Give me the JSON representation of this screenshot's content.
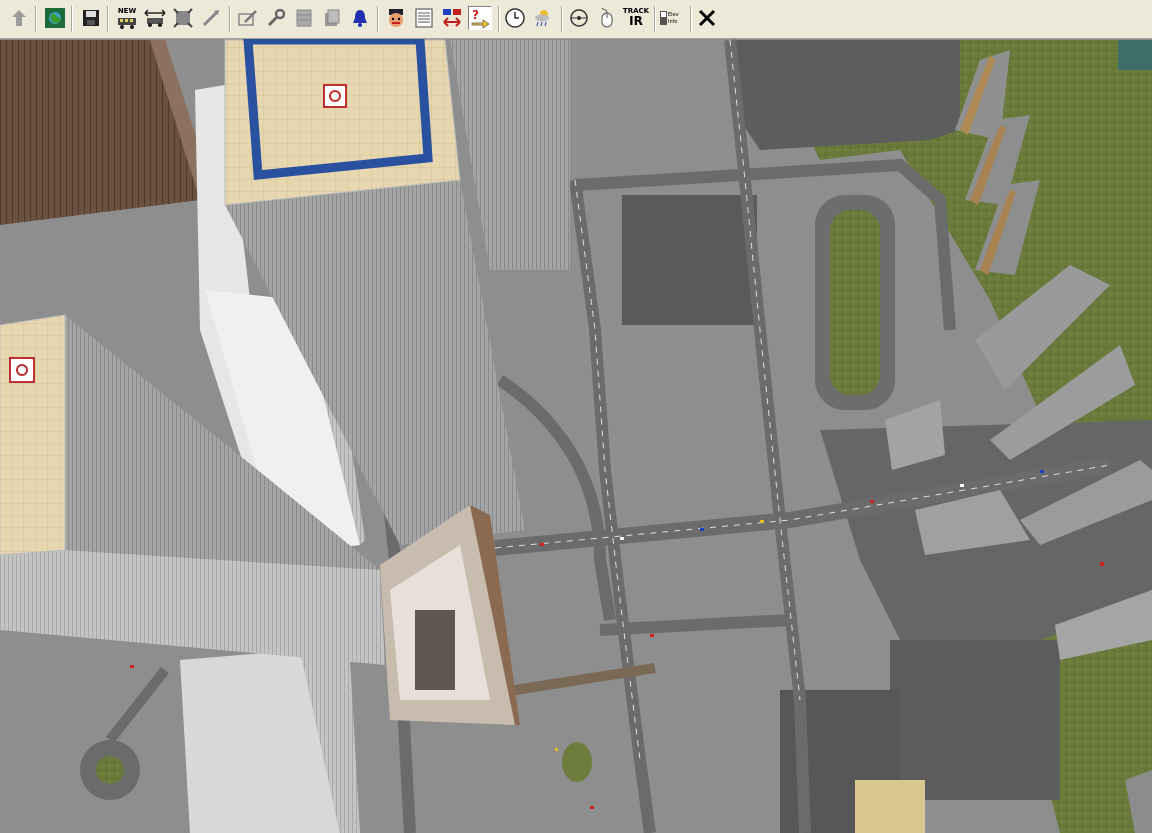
{
  "toolbar": {
    "new_label": "NEW",
    "track_label_top": "TRACK",
    "track_label_bottom": "IR",
    "opt_line1": "Elev",
    "opt_line2": "Info",
    "buttons": [
      {
        "name": "up-arrow-icon"
      },
      {
        "name": "map-terrain-icon"
      },
      {
        "name": "save-icon"
      },
      {
        "name": "new-train-icon"
      },
      {
        "name": "couple-train-icon"
      },
      {
        "name": "select-area-icon"
      },
      {
        "name": "drag-tool-icon"
      },
      {
        "name": "edit-track-icon"
      },
      {
        "name": "wrench-icon"
      },
      {
        "name": "grid-tool-icon"
      },
      {
        "name": "layer-tool-icon"
      },
      {
        "name": "bell-icon"
      },
      {
        "name": "driver-icon"
      },
      {
        "name": "schedule-icon"
      },
      {
        "name": "switch-direction-icon"
      },
      {
        "name": "help-pointer-icon"
      },
      {
        "name": "clock-icon"
      },
      {
        "name": "weather-icon"
      },
      {
        "name": "compass-icon"
      },
      {
        "name": "mouse-icon"
      },
      {
        "name": "track-ir-icon"
      },
      {
        "name": "options-checkbox-icon"
      },
      {
        "name": "close-icon"
      }
    ]
  },
  "scene": {
    "colors": {
      "ground": "#8e8e8e",
      "road": "#6b6b6b",
      "grass": "#6a7a3c",
      "roof": "#e8d9b5",
      "facade": "#9c9c9c",
      "brown": "#6e5440"
    }
  }
}
